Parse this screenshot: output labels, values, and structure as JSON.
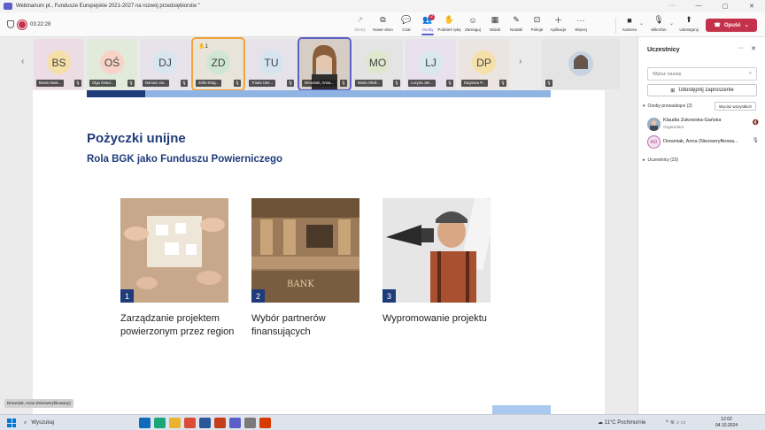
{
  "window": {
    "title": "Webinarium pt., Fundusze Europejskie 2021-2027 na rozwój przedsiębiorstw \""
  },
  "toolbar": {
    "timer": "03:22:28",
    "tools": [
      {
        "label": "Skróty",
        "icon": "↗",
        "state": "disabled"
      },
      {
        "label": "Nowe okno",
        "icon": "⧉",
        "state": ""
      },
      {
        "label": "Czat",
        "icon": "💬",
        "state": ""
      },
      {
        "label": "Osoby",
        "icon": "👥",
        "state": "active",
        "badge": "2"
      },
      {
        "label": "Podnieś rękę",
        "icon": "✋",
        "state": ""
      },
      {
        "label": "Zareaguj",
        "icon": "☺",
        "state": ""
      },
      {
        "label": "Widok",
        "icon": "▦",
        "state": ""
      },
      {
        "label": "Notatki",
        "icon": "✎",
        "state": ""
      },
      {
        "label": "Pokoje",
        "icon": "⊡",
        "state": ""
      },
      {
        "label": "Aplikacje",
        "icon": "＋",
        "state": ""
      },
      {
        "label": "Więcej",
        "icon": "···",
        "state": ""
      }
    ],
    "camera_label": "Kamera",
    "mic_label": "Mikrofon",
    "share_label": "Udostępnij",
    "leave_label": "Opuść"
  },
  "participants_strip": [
    {
      "initials": "BS",
      "name": "Beata Stasi...",
      "color": "#f4e0a8",
      "bg": "#ecdce4"
    },
    {
      "initials": "OŚ",
      "name": "Olga Śniad...",
      "color": "#f7d3c8",
      "bg": "#e2eadc"
    },
    {
      "initials": "DJ",
      "name": "Dariusz Jar...",
      "color": "#d8e6f2",
      "bg": "#e8e2ea"
    },
    {
      "initials": "ZD",
      "name": "Zofia Drag...",
      "color": "#cfe6d4",
      "bg": "#e8e4da",
      "speaking": true,
      "raised": "✋1"
    },
    {
      "initials": "TU",
      "name": "Triada Uter...",
      "color": "#d6e4f0",
      "bg": "#e6e2ea"
    },
    {
      "initials": "",
      "name": "Drewniak, Anna...",
      "color": "#c9b8a8",
      "bg": "#e0d8d0",
      "selected": true,
      "video": true
    },
    {
      "initials": "MO",
      "name": "Marta Okoli...",
      "color": "#dfe7cf",
      "bg": "#e4e4e4"
    },
    {
      "initials": "LJ",
      "name": "Lucyna Jan...",
      "color": "#d8e8ee",
      "bg": "#e8e0ec"
    },
    {
      "initials": "DP",
      "name": "Dagmara P...",
      "color": "#f4e0a8",
      "bg": "#ece4e0"
    },
    {
      "initials": "",
      "name": "",
      "color": "#b9c8d8",
      "bg": "#e4e4e4",
      "video": true
    }
  ],
  "slide": {
    "title": "Pożyczki unijne",
    "subtitle": "Rola BGK jako Funduszu Powierniczego",
    "cards": [
      {
        "number": "1",
        "caption": "Zarządzanie projektem powierzonym przez region"
      },
      {
        "number": "2",
        "caption": "Wybór partnerów finansujących"
      },
      {
        "number": "3",
        "caption": "Wypromowanie projektu"
      }
    ]
  },
  "presenter_chip": "Drewniak, Anna (Niezweryfikowany)",
  "panel": {
    "title": "Uczestnicy",
    "search_placeholder": "Wpisz nazwę",
    "share_invite": "Udostępnij zaproszenie",
    "presenters_section": "Osoby prowadzące (2)",
    "mute_all": "Wycisz wszystkich",
    "presenters": [
      {
        "name": "Klaudia Żukowska-Gańska",
        "role": "Organizator",
        "initials": "",
        "photo": true
      },
      {
        "name": "Drewniak, Anna (Niezweryfikowa...",
        "role": "",
        "initials": "AD",
        "photo": false
      }
    ],
    "attendees_section": "Uczestnicy (23)"
  },
  "taskbar": {
    "search_label": "Wyszukaj",
    "weather": "11°C Pochmurnie",
    "time": "12:02",
    "date": "04.10.2024"
  }
}
